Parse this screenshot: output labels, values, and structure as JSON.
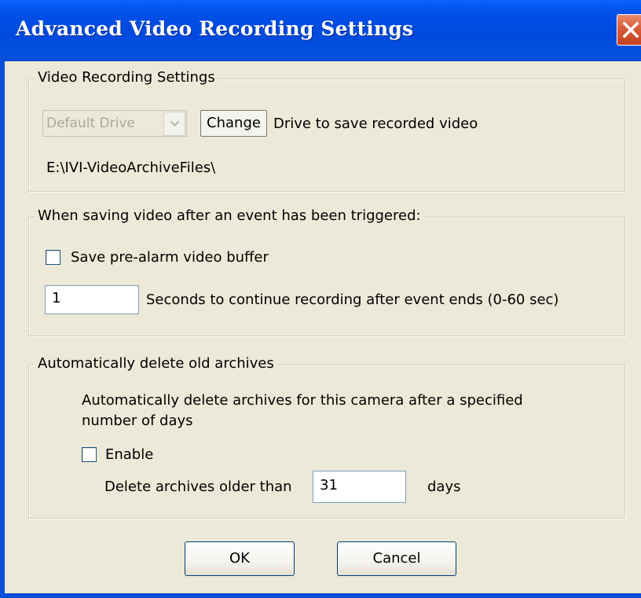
{
  "window": {
    "title": "Advanced Video Recording Settings",
    "close_icon": "close-icon",
    "colors": {
      "titlebar": "#0050e0",
      "client": "#ece9d8",
      "close": "#d95b38"
    }
  },
  "video_recording": {
    "legend": "Video Recording Settings",
    "drive_select": {
      "value": "Default Drive",
      "enabled": false
    },
    "change_button": "Change",
    "drive_label": "Drive to save recorded video",
    "path": "E:\\IVI-VideoArchiveFiles\\"
  },
  "event_saving": {
    "legend": "When saving video after an event has been triggered:",
    "pre_alarm_label": "Save pre-alarm video buffer",
    "pre_alarm_checked": false,
    "seconds_value": "1",
    "seconds_label": "Seconds to continue recording after event ends (0-60 sec)"
  },
  "auto_delete": {
    "legend": "Automatically delete old archives",
    "description_line1": "Automatically delete archives for this camera after a specified",
    "description_line2": "number of days",
    "enable_label": "Enable",
    "enable_checked": false,
    "older_than_label": "Delete archives older than",
    "days_value": "31",
    "days_label": "days"
  },
  "buttons": {
    "ok": "OK",
    "cancel": "Cancel"
  }
}
